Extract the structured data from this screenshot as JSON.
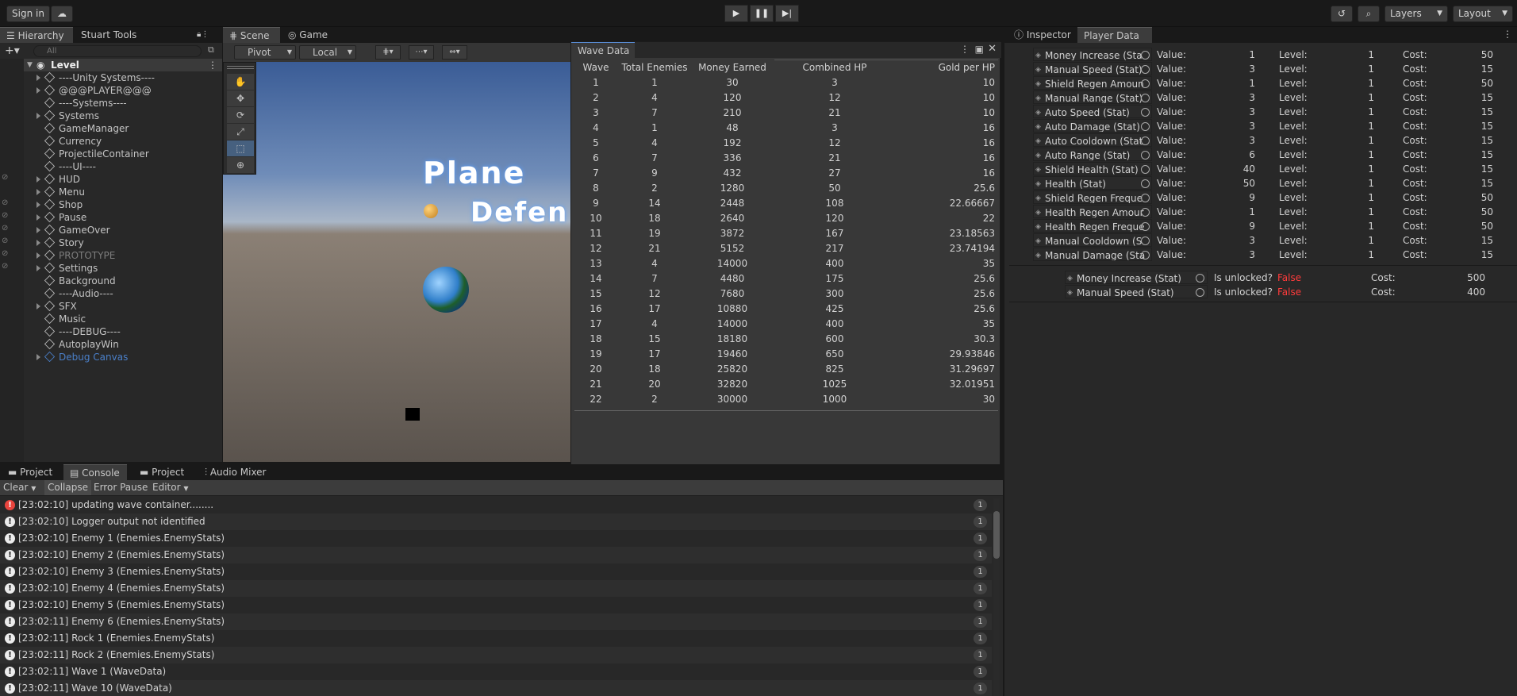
{
  "toolbar": {
    "sign_in": "Sign in",
    "layers": "Layers",
    "layout": "Layout"
  },
  "hierarchy": {
    "tabs": [
      "Hierarchy",
      "Stuart Tools"
    ],
    "search_placeholder": "All",
    "root": "Level",
    "items": [
      {
        "label": "----Unity Systems----",
        "arrow": true
      },
      {
        "label": "@@@PLAYER@@@",
        "arrow": true
      },
      {
        "label": "----Systems----",
        "arrow": false
      },
      {
        "label": "Systems",
        "arrow": true
      },
      {
        "label": "GameManager",
        "arrow": false
      },
      {
        "label": "Currency",
        "arrow": false
      },
      {
        "label": "ProjectileContainer",
        "arrow": false
      },
      {
        "label": "----UI----",
        "arrow": false
      },
      {
        "label": "HUD",
        "arrow": true
      },
      {
        "label": "Menu",
        "arrow": true
      },
      {
        "label": "Shop",
        "arrow": true
      },
      {
        "label": "Pause",
        "arrow": true
      },
      {
        "label": "GameOver",
        "arrow": true
      },
      {
        "label": "Story",
        "arrow": true
      },
      {
        "label": "PROTOTYPE",
        "arrow": true
      },
      {
        "label": "Settings",
        "arrow": true
      },
      {
        "label": "Background",
        "arrow": false
      },
      {
        "label": "----Audio----",
        "arrow": false
      },
      {
        "label": "SFX",
        "arrow": true
      },
      {
        "label": "Music",
        "arrow": false
      },
      {
        "label": "----DEBUG----",
        "arrow": false
      },
      {
        "label": "AutoplayWin",
        "arrow": false
      },
      {
        "label": "Debug Canvas",
        "arrow": true
      }
    ]
  },
  "scene": {
    "tabs": [
      "Scene",
      "Game"
    ],
    "pivot": "Pivot",
    "local": "Local",
    "title_line1": "Plane",
    "title_line2": "Defen"
  },
  "wave_data": {
    "title": "Wave Data",
    "headers": [
      "Wave",
      "Total Enemies",
      "Money Earned",
      "Combined HP",
      "Gold per HP"
    ],
    "rows": [
      [
        "1",
        "1",
        "30",
        "3",
        "10"
      ],
      [
        "2",
        "4",
        "120",
        "12",
        "10"
      ],
      [
        "3",
        "7",
        "210",
        "21",
        "10"
      ],
      [
        "4",
        "1",
        "48",
        "3",
        "16"
      ],
      [
        "5",
        "4",
        "192",
        "12",
        "16"
      ],
      [
        "6",
        "7",
        "336",
        "21",
        "16"
      ],
      [
        "7",
        "9",
        "432",
        "27",
        "16"
      ],
      [
        "8",
        "2",
        "1280",
        "50",
        "25.6"
      ],
      [
        "9",
        "14",
        "2448",
        "108",
        "22.66667"
      ],
      [
        "10",
        "18",
        "2640",
        "120",
        "22"
      ],
      [
        "11",
        "19",
        "3872",
        "167",
        "23.18563"
      ],
      [
        "12",
        "21",
        "5152",
        "217",
        "23.74194"
      ],
      [
        "13",
        "4",
        "14000",
        "400",
        "35"
      ],
      [
        "14",
        "7",
        "4480",
        "175",
        "25.6"
      ],
      [
        "15",
        "12",
        "7680",
        "300",
        "25.6"
      ],
      [
        "16",
        "17",
        "10880",
        "425",
        "25.6"
      ],
      [
        "17",
        "4",
        "14000",
        "400",
        "35"
      ],
      [
        "18",
        "15",
        "18180",
        "600",
        "30.3"
      ],
      [
        "19",
        "17",
        "19460",
        "650",
        "29.93846"
      ],
      [
        "20",
        "18",
        "25820",
        "825",
        "31.29697"
      ],
      [
        "21",
        "20",
        "32820",
        "1025",
        "32.01951"
      ],
      [
        "22",
        "2",
        "30000",
        "1000",
        "30"
      ]
    ]
  },
  "inspector": {
    "tabs": [
      "Inspector",
      "Player Data"
    ],
    "value_label": "Value:",
    "level_label": "Level:",
    "cost_label": "Cost:",
    "stats": [
      {
        "name": "Money Increase (Sta",
        "value": "1",
        "level": "1",
        "cost": "50"
      },
      {
        "name": "Manual Speed (Stat)",
        "value": "3",
        "level": "1",
        "cost": "15"
      },
      {
        "name": "Shield Regen Amoun",
        "value": "1",
        "level": "1",
        "cost": "50"
      },
      {
        "name": "Manual Range (Stat)",
        "value": "3",
        "level": "1",
        "cost": "15"
      },
      {
        "name": "Auto Speed (Stat)",
        "value": "3",
        "level": "1",
        "cost": "15"
      },
      {
        "name": "Auto Damage (Stat)",
        "value": "3",
        "level": "1",
        "cost": "15"
      },
      {
        "name": "Auto Cooldown (Stat",
        "value": "3",
        "level": "1",
        "cost": "15"
      },
      {
        "name": "Auto Range (Stat)",
        "value": "6",
        "level": "1",
        "cost": "15"
      },
      {
        "name": "Shield Health (Stat)",
        "value": "40",
        "level": "1",
        "cost": "15"
      },
      {
        "name": "Health (Stat)",
        "value": "50",
        "level": "1",
        "cost": "15"
      },
      {
        "name": "Shield Regen Freque",
        "value": "9",
        "level": "1",
        "cost": "50"
      },
      {
        "name": "Health Regen Amour",
        "value": "1",
        "level": "1",
        "cost": "50"
      },
      {
        "name": "Health Regen Freque",
        "value": "9",
        "level": "1",
        "cost": "50"
      },
      {
        "name": "Manual Cooldown (S",
        "value": "3",
        "level": "1",
        "cost": "15"
      },
      {
        "name": "Manual Damage (Sta",
        "value": "3",
        "level": "1",
        "cost": "15"
      }
    ],
    "unlock_label": "Is unlocked?",
    "unlocks": [
      {
        "name": "Money Increase (Stat)",
        "state": "False",
        "cost": "500"
      },
      {
        "name": "Manual Speed (Stat)",
        "state": "False",
        "cost": "400"
      }
    ],
    "false_color": "#ff3b3b"
  },
  "bottom": {
    "tabs": [
      "Project",
      "Console",
      "Project",
      "Audio Mixer"
    ],
    "console_buttons": [
      "Clear",
      "Collapse",
      "Error Pause",
      "Editor"
    ],
    "logs": [
      {
        "text": "[23:02:10] updating wave container........",
        "type": "error",
        "count": "1"
      },
      {
        "text": "[23:02:10] Logger output not identified",
        "type": "info",
        "count": "1"
      },
      {
        "text": "[23:02:10] Enemy 1 (Enemies.EnemyStats)",
        "type": "info",
        "count": "1"
      },
      {
        "text": "[23:02:10] Enemy 2 (Enemies.EnemyStats)",
        "type": "info",
        "count": "1"
      },
      {
        "text": "[23:02:10] Enemy 3 (Enemies.EnemyStats)",
        "type": "info",
        "count": "1"
      },
      {
        "text": "[23:02:10] Enemy 4 (Enemies.EnemyStats)",
        "type": "info",
        "count": "1"
      },
      {
        "text": "[23:02:10] Enemy 5 (Enemies.EnemyStats)",
        "type": "info",
        "count": "1"
      },
      {
        "text": "[23:02:11] Enemy 6 (Enemies.EnemyStats)",
        "type": "info",
        "count": "1"
      },
      {
        "text": "[23:02:11] Rock 1 (Enemies.EnemyStats)",
        "type": "info",
        "count": "1"
      },
      {
        "text": "[23:02:11] Rock 2 (Enemies.EnemyStats)",
        "type": "info",
        "count": "1"
      },
      {
        "text": "[23:02:11] Wave 1 (WaveData)",
        "type": "info",
        "count": "1"
      },
      {
        "text": "[23:02:11] Wave 10 (WaveData)",
        "type": "info",
        "count": "1"
      }
    ]
  }
}
